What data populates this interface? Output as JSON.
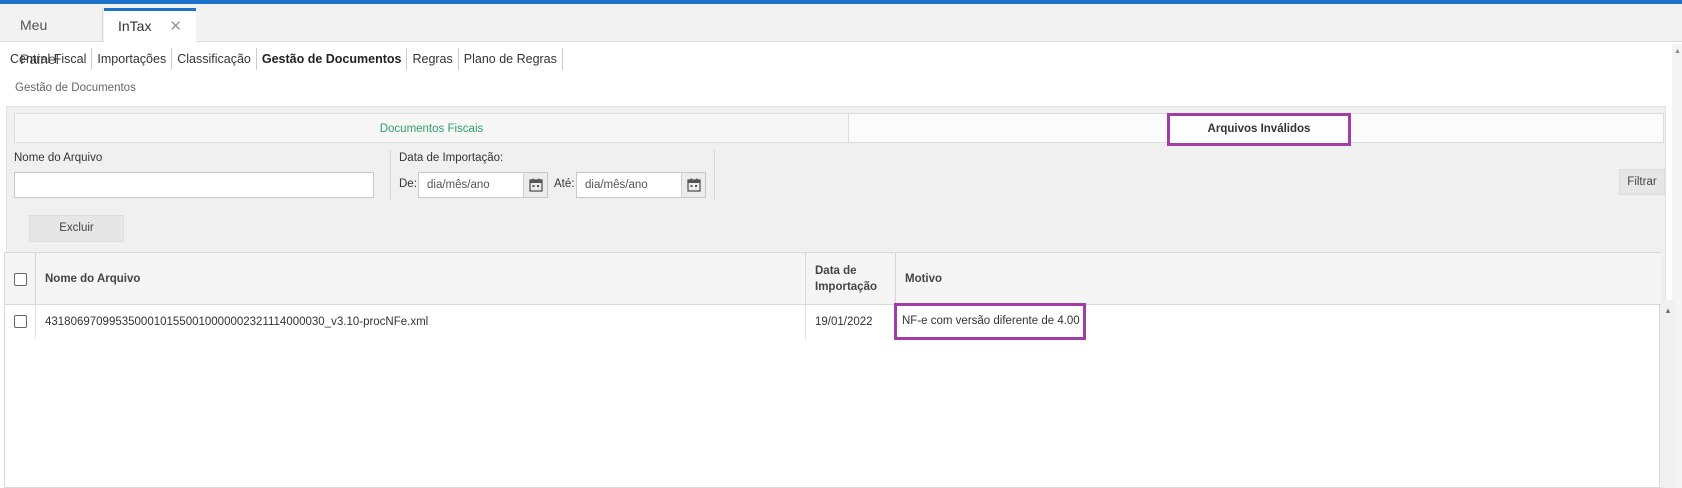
{
  "app_tabs": [
    {
      "label": "Meu Painel"
    },
    {
      "label": "InTax",
      "close": "✕"
    }
  ],
  "menu": [
    {
      "label": "Central Fiscal"
    },
    {
      "label": "Importações"
    },
    {
      "label": "Classificação"
    },
    {
      "label": "Gestão de Documentos"
    },
    {
      "label": "Regras"
    },
    {
      "label": "Plano de Regras"
    }
  ],
  "breadcrumb": "Gestão de Documentos",
  "subtabs": {
    "documentos": "Documentos Fiscais",
    "invalidos": "Arquivos Inválidos"
  },
  "filters": {
    "nome_label": "Nome do Arquivo",
    "nome_value": "",
    "data_label": "Data de Importação:",
    "de_label": "De:",
    "de_placeholder": "dia/mês/ano",
    "ate_label": "Até:",
    "ate_placeholder": "dia/mês/ano",
    "filtrar_label": "Filtrar",
    "excluir_label": "Excluir"
  },
  "table": {
    "columns": {
      "nome": "Nome do Arquivo",
      "data_line1": "Data de",
      "data_line2": "Importação",
      "motivo": "Motivo"
    },
    "rows": [
      {
        "nome": "43180697099535000101550010000002321114000030_v3.10-procNFe.xml",
        "data": "19/01/2022",
        "motivo": "NF-e com versão diferente de 4.00"
      }
    ]
  },
  "colors": {
    "accent_blue": "#1a73c9",
    "highlight": "#a13ca8",
    "tab_green": "#2e9e6b"
  },
  "icons": {
    "calendar": "calendar-icon",
    "close": "close-icon"
  }
}
